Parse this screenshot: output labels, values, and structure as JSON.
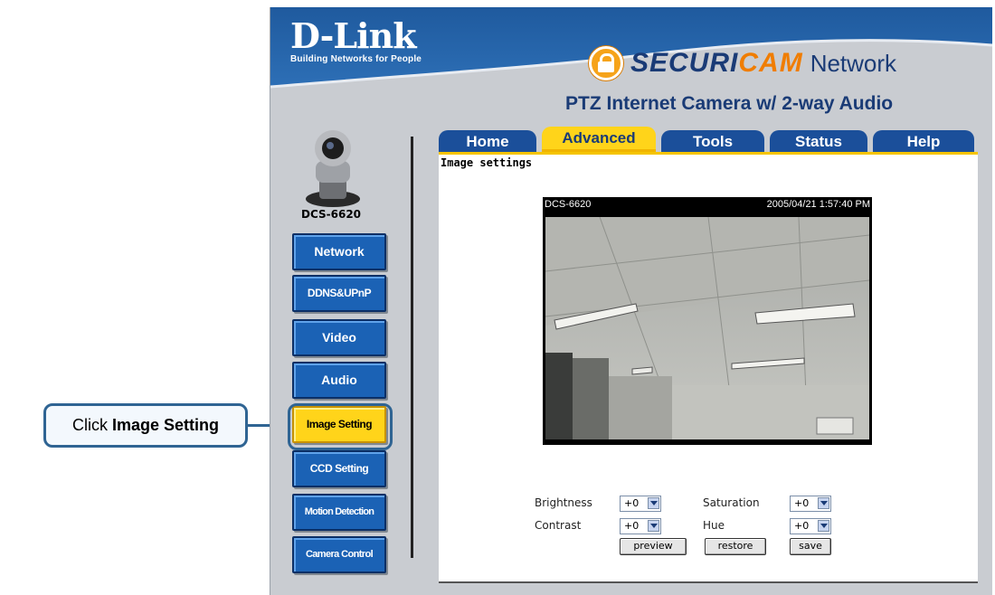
{
  "header": {
    "brand_logo": "D-Link",
    "brand_tagline": "Building Networks for People",
    "product_brand_part1": "SECURI",
    "product_brand_part2": "CAM",
    "product_brand_part3": "Network",
    "product_subtitle": "PTZ Internet Camera w/ 2-way Audio"
  },
  "tabs": [
    {
      "label": "Home"
    },
    {
      "label": "Advanced",
      "active": true
    },
    {
      "label": "Tools"
    },
    {
      "label": "Status"
    },
    {
      "label": "Help"
    }
  ],
  "sidebar": {
    "model": "DCS-6620",
    "items": [
      {
        "label": "Network"
      },
      {
        "label": "DDNS&UPnP"
      },
      {
        "label": "Video"
      },
      {
        "label": "Audio"
      },
      {
        "label": "Image Setting",
        "active": true
      },
      {
        "label": "CCD Setting"
      },
      {
        "label": "Motion Detection"
      },
      {
        "label": "Camera Control"
      }
    ]
  },
  "content": {
    "title": "Image settings",
    "video": {
      "camera_name": "DCS-6620",
      "timestamp": "2005/04/21 1:57:40 PM"
    },
    "controls": {
      "brightness_label": "Brightness",
      "brightness_value": "+0",
      "saturation_label": "Saturation",
      "saturation_value": "+0",
      "contrast_label": "Contrast",
      "contrast_value": "+0",
      "hue_label": "Hue",
      "hue_value": "+0",
      "preview_button": "preview",
      "restore_button": "restore",
      "save_button": "save"
    }
  },
  "callout": {
    "prefix": "Click",
    "target": "Image Setting"
  },
  "colors": {
    "header_blue": "#1b4f9a",
    "accent_yellow": "#ffd41a",
    "brand_orange": "#f07d00",
    "callout_border": "#2f6493"
  }
}
